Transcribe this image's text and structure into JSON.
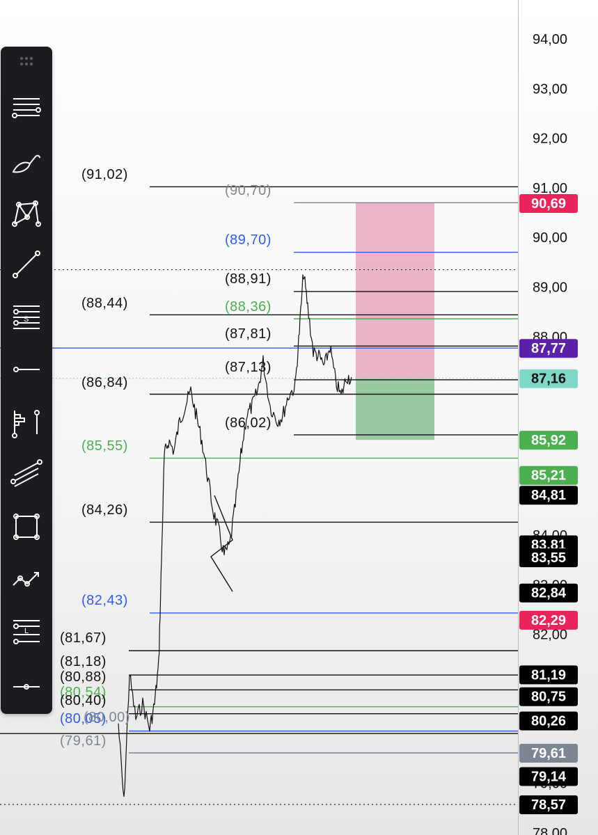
{
  "colors": {
    "black_line": "#111111",
    "blue_line": "#2f5cf0",
    "green_line": "#4caf50",
    "gray_line": "#7e8594",
    "pink_zone": "#e6a9bd",
    "green_zone": "#8fc496",
    "axis_text": "#111111"
  },
  "price_axis": {
    "ticks": [
      "94,00",
      "93,00",
      "92,00",
      "91,00",
      "90,00",
      "89,00",
      "88,00",
      "84,00",
      "83,00",
      "82,00",
      "79,00",
      "78,00"
    ]
  },
  "price_tags": [
    {
      "value": 90.69,
      "label": "90,69",
      "bg": "#e8245a",
      "fg": "#ffffff"
    },
    {
      "value": 87.77,
      "label": "87,77",
      "bg": "#5b21a8",
      "fg": "#ffffff"
    },
    {
      "value": 87.16,
      "label": "87,16",
      "bg": "#7fd7c8",
      "fg": "#111111"
    },
    {
      "value": 85.92,
      "label": "85,92",
      "bg": "#4caf50",
      "fg": "#ffffff"
    },
    {
      "value": 85.21,
      "label": "85,21",
      "bg": "#4caf50",
      "fg": "#ffffff"
    },
    {
      "value": 84.81,
      "label": "84,81",
      "bg": "#000000",
      "fg": "#ffffff"
    },
    {
      "value": 83.81,
      "label": "83,81",
      "bg": "#000000",
      "fg": "#ffffff"
    },
    {
      "value": 83.55,
      "label": "83,55",
      "bg": "#000000",
      "fg": "#ffffff"
    },
    {
      "value": 82.84,
      "label": "82,84",
      "bg": "#000000",
      "fg": "#ffffff"
    },
    {
      "value": 82.29,
      "label": "82,29",
      "bg": "#e8245a",
      "fg": "#ffffff"
    },
    {
      "value": 81.19,
      "label": "81,19",
      "bg": "#000000",
      "fg": "#ffffff"
    },
    {
      "value": 80.75,
      "label": "80,75",
      "bg": "#000000",
      "fg": "#ffffff"
    },
    {
      "value": 80.26,
      "label": "80,26",
      "bg": "#000000",
      "fg": "#ffffff"
    },
    {
      "value": 79.61,
      "label": "79,61",
      "bg": "#7e8594",
      "fg": "#ffffff"
    },
    {
      "value": 79.14,
      "label": "79,14",
      "bg": "#000000",
      "fg": "#ffffff"
    },
    {
      "value": 78.57,
      "label": "78,57",
      "bg": "#000000",
      "fg": "#ffffff"
    }
  ],
  "level_lines": [
    {
      "label": "(91,02)",
      "color": "black",
      "value": 91.02
    },
    {
      "label": "(90,70)",
      "color": "gray",
      "value": 90.7
    },
    {
      "label": "(89,70)",
      "color": "blue",
      "value": 89.7
    },
    {
      "label": "(88,91)",
      "color": "black",
      "value": 88.91
    },
    {
      "label": "(88,44)",
      "color": "black",
      "value": 88.44
    },
    {
      "label": "(88,36)",
      "color": "green",
      "value": 88.36
    },
    {
      "label": "(87,81)",
      "color": "black",
      "value": 87.81
    },
    {
      "label": "(87,13)",
      "color": "black",
      "value": 87.13
    },
    {
      "label": "(86,84)",
      "color": "black",
      "value": 86.84
    },
    {
      "label": "(86,02)",
      "color": "black",
      "value": 86.02
    },
    {
      "label": "(85,55)",
      "color": "green",
      "value": 85.55
    },
    {
      "label": "(84,26)",
      "color": "black",
      "value": 84.26
    },
    {
      "label": "(82,43)",
      "color": "blue",
      "value": 82.43
    },
    {
      "label": "(81,67)",
      "color": "black",
      "value": 81.67
    },
    {
      "label": "(81,18)",
      "color": "black",
      "value": 81.18
    },
    {
      "label": "(80,88)",
      "color": "black",
      "value": 80.88
    },
    {
      "label": "(80,54)",
      "color": "green",
      "value": 80.54
    },
    {
      "label": "(80,40)",
      "color": "black",
      "value": 80.4
    },
    {
      "label": "(80,05)",
      "color": "blue",
      "value": 80.05
    },
    {
      "label": "(80,00)",
      "color": "gray",
      "value": 80.0
    },
    {
      "label": "(79,61)",
      "color": "gray",
      "value": 79.61
    }
  ],
  "toolbar": {
    "tools": [
      {
        "name": "horizontal-lines-icon"
      },
      {
        "name": "brush-icon"
      },
      {
        "name": "pattern-icon"
      },
      {
        "name": "trend-line-icon"
      },
      {
        "name": "support-resistance-icon"
      },
      {
        "name": "horizontal-ray-icon"
      },
      {
        "name": "volume-profile-icon"
      },
      {
        "name": "parallel-channel-icon"
      },
      {
        "name": "rectangle-icon"
      },
      {
        "name": "polyline-icon"
      },
      {
        "name": "level-lines-icon"
      },
      {
        "name": "horizontal-line-icon"
      }
    ]
  }
}
